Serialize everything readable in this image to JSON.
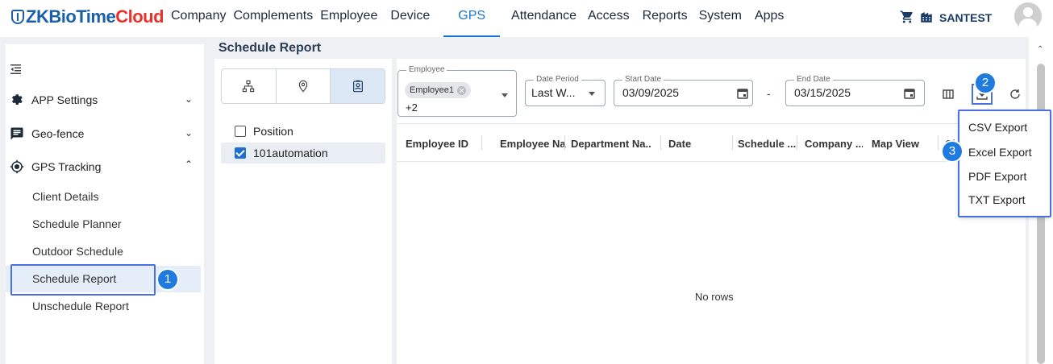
{
  "app": {
    "logo_prefix": "ZKBioTime",
    "logo_suffix": "Cloud"
  },
  "nav": {
    "items": [
      "Company",
      "Complements",
      "Employee",
      "Device",
      "GPS",
      "Attendance",
      "Access",
      "Reports",
      "System",
      "Apps"
    ],
    "active": "GPS",
    "user": "SANTEST"
  },
  "sidebar": {
    "groups": [
      {
        "label": "APP Settings",
        "icon": "gear-icon"
      },
      {
        "label": "Geo-fence",
        "icon": "message-icon"
      },
      {
        "label": "GPS Tracking",
        "icon": "location-target-icon"
      }
    ],
    "items": [
      "Client Details",
      "Schedule Planner",
      "Outdoor Schedule",
      "Schedule Report",
      "Unschedule Report"
    ],
    "active": "Schedule Report"
  },
  "page": {
    "title": "Schedule Report"
  },
  "tree": {
    "tabs": [
      "org-chart-icon",
      "location-pin-icon",
      "id-badge-icon"
    ],
    "rows": [
      {
        "label": "Position",
        "checked": false
      },
      {
        "label": "101automation",
        "checked": true
      }
    ]
  },
  "filters": {
    "employee": {
      "label": "Employee",
      "chip": "Employee1",
      "more": "+2"
    },
    "date_period": {
      "label": "Date Period",
      "value": "Last W..."
    },
    "start_date": {
      "label": "Start Date",
      "value": "03/09/2025"
    },
    "end_date": {
      "label": "End Date",
      "value": "03/15/2025"
    },
    "separator": "-"
  },
  "grid": {
    "columns": [
      "Employee ID",
      "Employee Na...",
      "Department Na...",
      "Date",
      "Schedule ...",
      "Company ...",
      "Map View",
      "Ch"
    ],
    "empty_text": "No rows"
  },
  "export_menu": {
    "items": [
      "CSV Export",
      "Excel Export",
      "PDF Export",
      "TXT Export"
    ]
  },
  "annotations": {
    "badges": [
      "1",
      "2",
      "3"
    ],
    "accent": "#1f7be0",
    "box_color": "#4a6fe0"
  },
  "colors": {
    "primary": "#1976d2",
    "logo_blue": "#1a5fa8",
    "logo_red": "#e8332a"
  }
}
